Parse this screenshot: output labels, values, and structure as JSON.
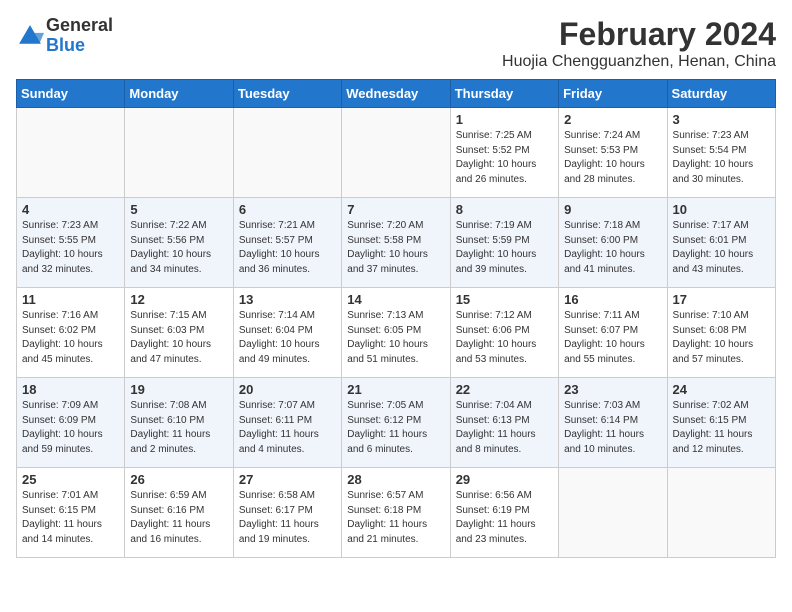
{
  "header": {
    "logo_general": "General",
    "logo_blue": "Blue",
    "title": "February 2024",
    "subtitle": "Huojia Chengguanzhen, Henan, China"
  },
  "days_of_week": [
    "Sunday",
    "Monday",
    "Tuesday",
    "Wednesday",
    "Thursday",
    "Friday",
    "Saturday"
  ],
  "weeks": [
    [
      {
        "day": "",
        "info": ""
      },
      {
        "day": "",
        "info": ""
      },
      {
        "day": "",
        "info": ""
      },
      {
        "day": "",
        "info": ""
      },
      {
        "day": "1",
        "info": "Sunrise: 7:25 AM\nSunset: 5:52 PM\nDaylight: 10 hours\nand 26 minutes."
      },
      {
        "day": "2",
        "info": "Sunrise: 7:24 AM\nSunset: 5:53 PM\nDaylight: 10 hours\nand 28 minutes."
      },
      {
        "day": "3",
        "info": "Sunrise: 7:23 AM\nSunset: 5:54 PM\nDaylight: 10 hours\nand 30 minutes."
      }
    ],
    [
      {
        "day": "4",
        "info": "Sunrise: 7:23 AM\nSunset: 5:55 PM\nDaylight: 10 hours\nand 32 minutes."
      },
      {
        "day": "5",
        "info": "Sunrise: 7:22 AM\nSunset: 5:56 PM\nDaylight: 10 hours\nand 34 minutes."
      },
      {
        "day": "6",
        "info": "Sunrise: 7:21 AM\nSunset: 5:57 PM\nDaylight: 10 hours\nand 36 minutes."
      },
      {
        "day": "7",
        "info": "Sunrise: 7:20 AM\nSunset: 5:58 PM\nDaylight: 10 hours\nand 37 minutes."
      },
      {
        "day": "8",
        "info": "Sunrise: 7:19 AM\nSunset: 5:59 PM\nDaylight: 10 hours\nand 39 minutes."
      },
      {
        "day": "9",
        "info": "Sunrise: 7:18 AM\nSunset: 6:00 PM\nDaylight: 10 hours\nand 41 minutes."
      },
      {
        "day": "10",
        "info": "Sunrise: 7:17 AM\nSunset: 6:01 PM\nDaylight: 10 hours\nand 43 minutes."
      }
    ],
    [
      {
        "day": "11",
        "info": "Sunrise: 7:16 AM\nSunset: 6:02 PM\nDaylight: 10 hours\nand 45 minutes."
      },
      {
        "day": "12",
        "info": "Sunrise: 7:15 AM\nSunset: 6:03 PM\nDaylight: 10 hours\nand 47 minutes."
      },
      {
        "day": "13",
        "info": "Sunrise: 7:14 AM\nSunset: 6:04 PM\nDaylight: 10 hours\nand 49 minutes."
      },
      {
        "day": "14",
        "info": "Sunrise: 7:13 AM\nSunset: 6:05 PM\nDaylight: 10 hours\nand 51 minutes."
      },
      {
        "day": "15",
        "info": "Sunrise: 7:12 AM\nSunset: 6:06 PM\nDaylight: 10 hours\nand 53 minutes."
      },
      {
        "day": "16",
        "info": "Sunrise: 7:11 AM\nSunset: 6:07 PM\nDaylight: 10 hours\nand 55 minutes."
      },
      {
        "day": "17",
        "info": "Sunrise: 7:10 AM\nSunset: 6:08 PM\nDaylight: 10 hours\nand 57 minutes."
      }
    ],
    [
      {
        "day": "18",
        "info": "Sunrise: 7:09 AM\nSunset: 6:09 PM\nDaylight: 10 hours\nand 59 minutes."
      },
      {
        "day": "19",
        "info": "Sunrise: 7:08 AM\nSunset: 6:10 PM\nDaylight: 11 hours\nand 2 minutes."
      },
      {
        "day": "20",
        "info": "Sunrise: 7:07 AM\nSunset: 6:11 PM\nDaylight: 11 hours\nand 4 minutes."
      },
      {
        "day": "21",
        "info": "Sunrise: 7:05 AM\nSunset: 6:12 PM\nDaylight: 11 hours\nand 6 minutes."
      },
      {
        "day": "22",
        "info": "Sunrise: 7:04 AM\nSunset: 6:13 PM\nDaylight: 11 hours\nand 8 minutes."
      },
      {
        "day": "23",
        "info": "Sunrise: 7:03 AM\nSunset: 6:14 PM\nDaylight: 11 hours\nand 10 minutes."
      },
      {
        "day": "24",
        "info": "Sunrise: 7:02 AM\nSunset: 6:15 PM\nDaylight: 11 hours\nand 12 minutes."
      }
    ],
    [
      {
        "day": "25",
        "info": "Sunrise: 7:01 AM\nSunset: 6:15 PM\nDaylight: 11 hours\nand 14 minutes."
      },
      {
        "day": "26",
        "info": "Sunrise: 6:59 AM\nSunset: 6:16 PM\nDaylight: 11 hours\nand 16 minutes."
      },
      {
        "day": "27",
        "info": "Sunrise: 6:58 AM\nSunset: 6:17 PM\nDaylight: 11 hours\nand 19 minutes."
      },
      {
        "day": "28",
        "info": "Sunrise: 6:57 AM\nSunset: 6:18 PM\nDaylight: 11 hours\nand 21 minutes."
      },
      {
        "day": "29",
        "info": "Sunrise: 6:56 AM\nSunset: 6:19 PM\nDaylight: 11 hours\nand 23 minutes."
      },
      {
        "day": "",
        "info": ""
      },
      {
        "day": "",
        "info": ""
      }
    ]
  ]
}
